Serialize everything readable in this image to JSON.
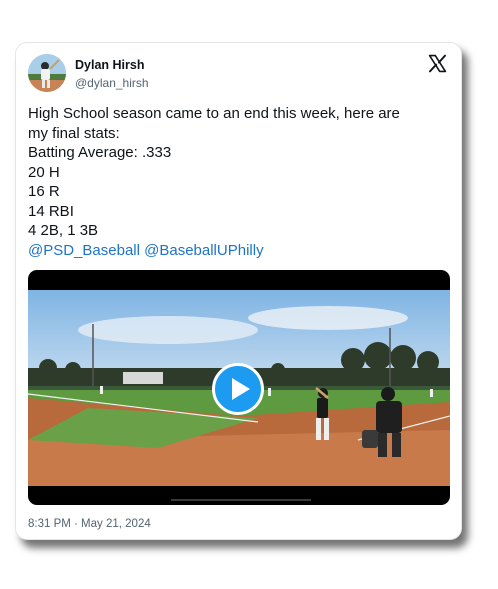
{
  "author": {
    "display_name": "Dylan Hirsh",
    "handle": "@dylan_hirsh",
    "avatar_icon": "baseball-player-avatar"
  },
  "brand_icon": "x-logo-icon",
  "tweet": {
    "lines": [
      "High School season came to an end this week, here are",
      "my final stats:",
      "Batting Average: .333",
      "20 H",
      "16 R",
      "14 RBI",
      "4 2B, 1 3B"
    ],
    "mentions": [
      "@PSD_Baseball",
      "@BaseballUPhilly"
    ]
  },
  "media": {
    "type": "video",
    "play_icon": "play-icon",
    "scene": "baseball-field-batter-umpire"
  },
  "timestamp": "8:31 PM · May 21, 2024",
  "colors": {
    "link": "#1d74c8",
    "play_button": "#1d9bf0",
    "text": "#0f1419",
    "secondary_text": "#536471"
  }
}
